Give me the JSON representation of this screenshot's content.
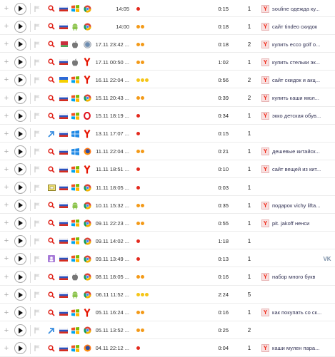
{
  "colors": {
    "red": "#e32a1e",
    "orange": "#f39a19",
    "yellow": "#f5c518",
    "keyword_link": "#335"
  },
  "rows": [
    {
      "time": "14:05",
      "level": "red",
      "dots": 1,
      "duration": "0:15",
      "views": "1",
      "keyword": "souline одежда ку...",
      "os": "windows-xp-icon",
      "browser": "chrome-icon",
      "country": "russia-flag-icon",
      "source": "search-icon",
      "vk": false
    },
    {
      "time": "14:00",
      "level": "orange",
      "dots": 2,
      "duration": "0:18",
      "views": "1",
      "keyword": "сайт tindeo скидок",
      "os": "android-icon",
      "browser": "chrome-icon",
      "country": "russia-flag-icon",
      "source": "search-icon",
      "vk": false
    },
    {
      "time": "17.11 23:42 ...",
      "level": "orange",
      "dots": 2,
      "duration": "0:18",
      "views": "2",
      "keyword": "купить ecco golf о...",
      "os": "apple-icon",
      "browser": "safari-icon",
      "country": "belarus-flag-icon",
      "source": "search-icon",
      "vk": false
    },
    {
      "time": "17.11 00:50 ...",
      "level": "orange",
      "dots": 2,
      "duration": "1:02",
      "views": "1",
      "keyword": "купить стельки эк...",
      "os": "apple-icon",
      "browser": "yandex-icon",
      "country": "russia-flag-icon",
      "source": "search-icon",
      "vk": false
    },
    {
      "time": "16.11 22:04 ...",
      "level": "yellow",
      "dots": 3,
      "duration": "0:56",
      "views": "2",
      "keyword": "сайт скидок и акц...",
      "os": "windows-xp-icon",
      "browser": "yandex-icon",
      "country": "ukraine-flag-icon",
      "source": "search-icon",
      "vk": false
    },
    {
      "time": "15.11 20:43 ...",
      "level": "orange",
      "dots": 2,
      "duration": "0:39",
      "views": "2",
      "keyword": "купить каши мюл...",
      "os": "windows-xp-icon",
      "browser": "chrome-icon",
      "country": "russia-flag-icon",
      "source": "search-icon",
      "vk": false
    },
    {
      "time": "15.11 18:19 ...",
      "level": "red",
      "dots": 1,
      "duration": "0:34",
      "views": "1",
      "keyword": "экко детская обув...",
      "os": "windows-xp-icon",
      "browser": "opera-icon",
      "country": "russia-flag-icon",
      "source": "search-icon",
      "vk": false
    },
    {
      "time": "13.11 17:07 ...",
      "level": "red",
      "dots": 1,
      "duration": "0:15",
      "views": "1",
      "keyword": "",
      "os": "windows-8-icon",
      "browser": "yandex-icon",
      "country": "russia-flag-icon",
      "source": "link-arrow-icon",
      "vk": false
    },
    {
      "time": "11.11 22:04 ...",
      "level": "orange",
      "dots": 2,
      "duration": "0:21",
      "views": "1",
      "keyword": "дешевые китайск...",
      "os": "windows-8-icon",
      "browser": "firefox-icon",
      "country": "russia-flag-icon",
      "source": "search-icon",
      "vk": false
    },
    {
      "time": "11.11 18:51 ...",
      "level": "red",
      "dots": 1,
      "duration": "0:10",
      "views": "1",
      "keyword": "сайт вещей из кит...",
      "os": "windows-xp-icon",
      "browser": "yandex-icon",
      "country": "russia-flag-icon",
      "source": "search-icon",
      "vk": false
    },
    {
      "time": "11.11 18:05 ...",
      "level": "red",
      "dots": 1,
      "duration": "0:03",
      "views": "1",
      "keyword": "",
      "os": "windows-xp-icon",
      "browser": "chrome-icon",
      "country": "russia-flag-icon",
      "source": "direct-icon",
      "vk": false
    },
    {
      "time": "10.11 15:32 ...",
      "level": "orange",
      "dots": 2,
      "duration": "0:35",
      "views": "1",
      "keyword": "подарок vichy lifta...",
      "os": "android-icon",
      "browser": "chrome-icon",
      "country": "russia-flag-icon",
      "source": "search-icon",
      "vk": false
    },
    {
      "time": "09.11 22:23 ...",
      "level": "orange",
      "dots": 2,
      "duration": "0:55",
      "views": "1",
      "keyword": "pit. jakoff ненси",
      "os": "windows-xp-icon",
      "browser": "chrome-icon",
      "country": "russia-flag-icon",
      "source": "search-icon",
      "vk": false
    },
    {
      "time": "09.11 14:02 ...",
      "level": "red",
      "dots": 1,
      "duration": "1:18",
      "views": "1",
      "keyword": "",
      "os": "windows-xp-icon",
      "browser": "chrome-icon",
      "country": "russia-flag-icon",
      "source": "search-icon",
      "vk": false
    },
    {
      "time": "09.11 13:49 ...",
      "level": "red",
      "dots": 1,
      "duration": "0:13",
      "views": "1",
      "keyword": "",
      "os": "windows-xp-icon",
      "browser": "chrome-icon",
      "country": "russia-flag-icon",
      "source": "social-icon",
      "vk": true,
      "vk_label": "VK"
    },
    {
      "time": "08.11 18:05 ...",
      "level": "orange",
      "dots": 2,
      "duration": "0:16",
      "views": "1",
      "keyword": "набор много букв",
      "os": "apple-icon",
      "browser": "chrome-icon",
      "country": "russia-flag-icon",
      "source": "search-icon",
      "vk": false
    },
    {
      "time": "06.11 11:52 ...",
      "level": "yellow",
      "dots": 3,
      "duration": "2:24",
      "views": "5",
      "keyword": "",
      "os": "android-icon",
      "browser": "chrome-icon",
      "country": "russia-flag-icon",
      "source": "search-icon",
      "vk": false
    },
    {
      "time": "05.11 16:24 ...",
      "level": "orange",
      "dots": 2,
      "duration": "0:16",
      "views": "1",
      "keyword": "как покупать со ск...",
      "os": "windows-xp-icon",
      "browser": "yandex-icon",
      "country": "russia-flag-icon",
      "source": "search-icon",
      "vk": false
    },
    {
      "time": "05.11 13:52 ...",
      "level": "orange",
      "dots": 2,
      "duration": "0:25",
      "views": "2",
      "keyword": "",
      "os": "windows-xp-icon",
      "browser": "chrome-icon",
      "country": "russia-flag-icon",
      "source": "link-arrow-icon",
      "vk": false
    },
    {
      "time": "04.11 22:12 ...",
      "level": "red",
      "dots": 1,
      "duration": "0:04",
      "views": "1",
      "keyword": "каши мулен пара...",
      "os": "windows-xp-icon",
      "browser": "firefox-icon",
      "country": "russia-flag-icon",
      "source": "search-icon",
      "vk": false
    }
  ]
}
